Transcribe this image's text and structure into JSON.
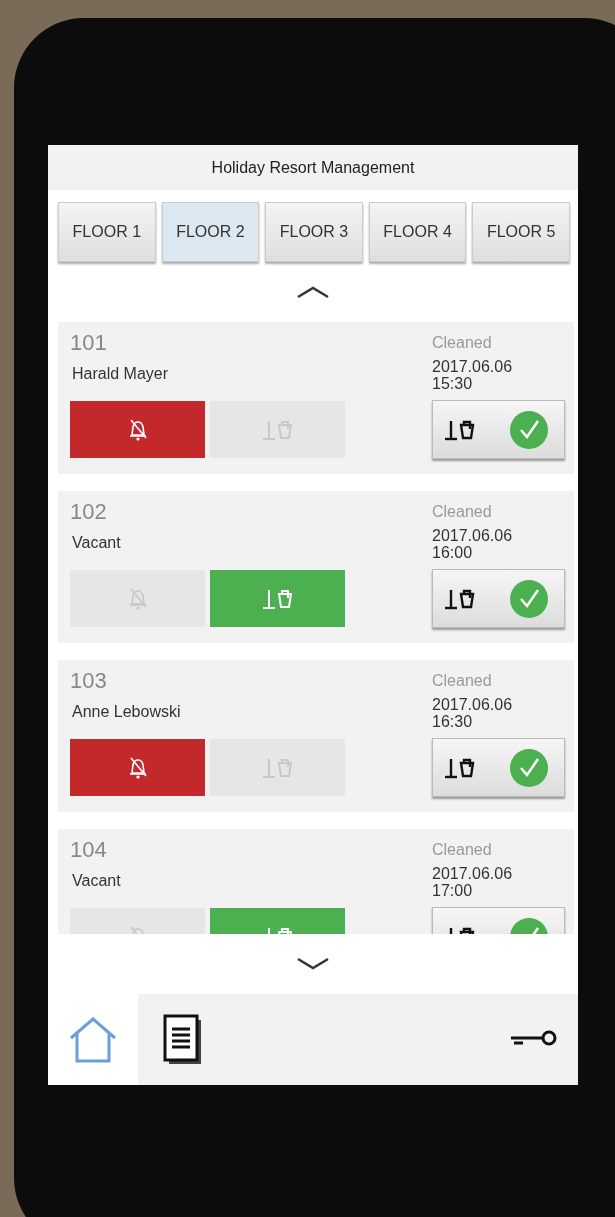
{
  "title": "Holiday Resort Management",
  "floors": [
    {
      "label": "FLOOR 1",
      "selected": false
    },
    {
      "label": "FLOOR 2",
      "selected": true
    },
    {
      "label": "FLOOR 3",
      "selected": false
    },
    {
      "label": "FLOOR 4",
      "selected": false
    },
    {
      "label": "FLOOR 5",
      "selected": false
    }
  ],
  "rooms": [
    {
      "number": "101",
      "guest": "Harald Mayer",
      "alarm": true,
      "cleaning_requested": false,
      "status": "Cleaned",
      "date": "2017.06.06",
      "time": "15:30"
    },
    {
      "number": "102",
      "guest": "Vacant",
      "alarm": false,
      "cleaning_requested": true,
      "status": "Cleaned",
      "date": "2017.06.06",
      "time": "16:00"
    },
    {
      "number": "103",
      "guest": "Anne Lebowski",
      "alarm": true,
      "cleaning_requested": false,
      "status": "Cleaned",
      "date": "2017.06.06",
      "time": "16:30"
    },
    {
      "number": "104",
      "guest": "Vacant",
      "alarm": false,
      "cleaning_requested": true,
      "status": "Cleaned",
      "date": "2017.06.06",
      "time": "17:00"
    }
  ],
  "nav": [
    {
      "kind": "home",
      "selected": true
    },
    {
      "kind": "report",
      "selected": false
    },
    {
      "kind": "key",
      "selected": false
    }
  ]
}
